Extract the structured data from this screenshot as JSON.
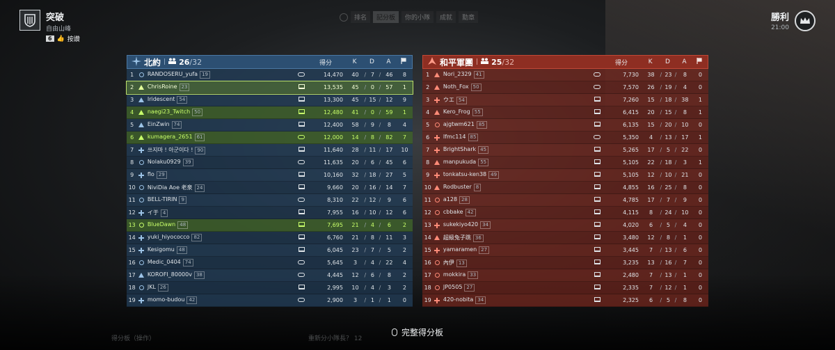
{
  "top_left": {
    "name": "突破",
    "subtitle": "自由山峰",
    "likes_count": "6",
    "likes_label": "按讚"
  },
  "top_tabs": [
    "排名",
    "記分板",
    "你的小隊",
    "成就",
    "勳章"
  ],
  "result": {
    "label": "勝利",
    "time": "21:00"
  },
  "columns": {
    "score": "得分",
    "k": "K",
    "d": "D",
    "a": "A"
  },
  "blue": {
    "name": "北約",
    "count": "26",
    "max": "/32",
    "players": [
      {
        "rank": "1",
        "icon": "ring",
        "name": "RANDOSERU_yufa",
        "lvl": "19",
        "plat": "ctrl",
        "score": "14,470",
        "k": "40",
        "d": "7",
        "a": "46",
        "f": "8",
        "state": ""
      },
      {
        "rank": "2",
        "icon": "tri",
        "name": "ChrisRoine",
        "lvl": "23",
        "plat": "pc",
        "score": "13,535",
        "k": "45",
        "d": "0",
        "a": "57",
        "f": "1",
        "state": "self"
      },
      {
        "rank": "3",
        "icon": "tri",
        "name": "Iridescent",
        "lvl": "54",
        "plat": "pc",
        "score": "13,300",
        "k": "45",
        "d": "15",
        "a": "12",
        "f": "9",
        "state": ""
      },
      {
        "rank": "4",
        "icon": "tri",
        "name": "naegi23_Twitch",
        "lvl": "50",
        "plat": "pc",
        "score": "12,480",
        "k": "41",
        "d": "0",
        "a": "59",
        "f": "1",
        "state": "squad"
      },
      {
        "rank": "5",
        "icon": "tri",
        "name": "EinZwin",
        "lvl": "74",
        "plat": "pc",
        "score": "12,400",
        "k": "58",
        "d": "9",
        "a": "8",
        "f": "4",
        "state": ""
      },
      {
        "rank": "6",
        "icon": "tri",
        "name": "kumagera_2651",
        "lvl": "61",
        "plat": "ctrl",
        "score": "12,000",
        "k": "14",
        "d": "8",
        "a": "82",
        "f": "7",
        "state": "squad"
      },
      {
        "rank": "7",
        "icon": "cross",
        "name": "쓰지마 ! 아군이다 !",
        "lvl": "90",
        "plat": "pc",
        "score": "11,640",
        "k": "28",
        "d": "11",
        "a": "17",
        "f": "10",
        "state": ""
      },
      {
        "rank": "8",
        "icon": "ring",
        "name": "Nolaku0929",
        "lvl": "39",
        "plat": "ctrl",
        "score": "11,635",
        "k": "20",
        "d": "6",
        "a": "45",
        "f": "6",
        "state": ""
      },
      {
        "rank": "9",
        "icon": "cross",
        "name": "flo",
        "lvl": "29",
        "plat": "pc",
        "score": "10,160",
        "k": "32",
        "d": "18",
        "a": "27",
        "f": "5",
        "state": ""
      },
      {
        "rank": "10",
        "icon": "ring",
        "name": "NiviDia Aoe 老泉",
        "lvl": "24",
        "plat": "pc",
        "score": "9,660",
        "k": "20",
        "d": "16",
        "a": "14",
        "f": "7",
        "state": ""
      },
      {
        "rank": "11",
        "icon": "ring",
        "name": "BELL-TIRIN",
        "lvl": "9",
        "plat": "ctrl",
        "score": "8,310",
        "k": "22",
        "d": "12",
        "a": "9",
        "f": "6",
        "state": ""
      },
      {
        "rank": "12",
        "icon": "cross",
        "name": "イ于",
        "lvl": "4",
        "plat": "pc",
        "score": "7,955",
        "k": "16",
        "d": "10",
        "a": "12",
        "f": "6",
        "state": ""
      },
      {
        "rank": "13",
        "icon": "ring",
        "name": "BlueDawn",
        "lvl": "48",
        "plat": "pc",
        "score": "7,695",
        "k": "21",
        "d": "4",
        "a": "6",
        "f": "2",
        "state": "squad"
      },
      {
        "rank": "14",
        "icon": "cross",
        "name": "yuki_hiyococco",
        "lvl": "82",
        "plat": "pc",
        "score": "6,760",
        "k": "21",
        "d": "8",
        "a": "11",
        "f": "3",
        "state": ""
      },
      {
        "rank": "15",
        "icon": "cross",
        "name": "Kesigomu",
        "lvl": "48",
        "plat": "pc",
        "score": "6,045",
        "k": "23",
        "d": "7",
        "a": "5",
        "f": "2",
        "state": ""
      },
      {
        "rank": "16",
        "icon": "ring",
        "name": "Medic_0404",
        "lvl": "74",
        "plat": "ctrl",
        "score": "5,645",
        "k": "3",
        "d": "4",
        "a": "22",
        "f": "4",
        "state": ""
      },
      {
        "rank": "17",
        "icon": "tri",
        "name": "KOROFI_80000v",
        "lvl": "38",
        "plat": "ctrl",
        "score": "4,445",
        "k": "12",
        "d": "6",
        "a": "8",
        "f": "2",
        "state": ""
      },
      {
        "rank": "18",
        "icon": "ring",
        "name": "JKL",
        "lvl": "26",
        "plat": "pc",
        "score": "2,995",
        "k": "10",
        "d": "4",
        "a": "3",
        "f": "2",
        "state": ""
      },
      {
        "rank": "19",
        "icon": "cross",
        "name": "momo-budou",
        "lvl": "42",
        "plat": "ctrl",
        "score": "2,900",
        "k": "3",
        "d": "1",
        "a": "1",
        "f": "0",
        "state": ""
      }
    ]
  },
  "red": {
    "name": "和平軍團",
    "count": "25",
    "max": "/32",
    "players": [
      {
        "rank": "1",
        "icon": "tri",
        "name": "Nori_2329",
        "lvl": "41",
        "plat": "ctrl",
        "score": "7,730",
        "k": "38",
        "d": "23",
        "a": "8",
        "f": "0"
      },
      {
        "rank": "2",
        "icon": "tri",
        "name": "Noth_Fox",
        "lvl": "50",
        "plat": "ctrl",
        "score": "7,570",
        "k": "26",
        "d": "19",
        "a": "4",
        "f": "0"
      },
      {
        "rank": "3",
        "icon": "cross",
        "name": "ウエ",
        "lvl": "54",
        "plat": "pc",
        "score": "7,260",
        "k": "15",
        "d": "18",
        "a": "38",
        "f": "1"
      },
      {
        "rank": "4",
        "icon": "tri",
        "name": "Kero_Frog",
        "lvl": "55",
        "plat": "pc",
        "score": "6,415",
        "k": "20",
        "d": "15",
        "a": "8",
        "f": "1"
      },
      {
        "rank": "5",
        "icon": "ring",
        "name": "ajgtwm621",
        "lvl": "85",
        "plat": "pc",
        "score": "6,135",
        "k": "15",
        "d": "20",
        "a": "10",
        "f": "0"
      },
      {
        "rank": "6",
        "icon": "cross",
        "name": "Ifmc114",
        "lvl": "85",
        "plat": "ctrl",
        "score": "5,350",
        "k": "4",
        "d": "13",
        "a": "17",
        "f": "1"
      },
      {
        "rank": "7",
        "icon": "cross",
        "name": "BrightShark",
        "lvl": "45",
        "plat": "pc",
        "score": "5,265",
        "k": "17",
        "d": "5",
        "a": "22",
        "f": "0"
      },
      {
        "rank": "8",
        "icon": "tri",
        "name": "manpukuda",
        "lvl": "55",
        "plat": "pc",
        "score": "5,105",
        "k": "22",
        "d": "18",
        "a": "3",
        "f": "1"
      },
      {
        "rank": "9",
        "icon": "cross",
        "name": "tonkatsu-ken38",
        "lvl": "49",
        "plat": "pc",
        "score": "5,105",
        "k": "12",
        "d": "10",
        "a": "21",
        "f": "0"
      },
      {
        "rank": "10",
        "icon": "tri",
        "name": "Rodbuster",
        "lvl": "8",
        "plat": "pc",
        "score": "4,855",
        "k": "16",
        "d": "25",
        "a": "8",
        "f": "0"
      },
      {
        "rank": "11",
        "icon": "ring",
        "name": "a128",
        "lvl": "28",
        "plat": "pc",
        "score": "4,785",
        "k": "17",
        "d": "7",
        "a": "9",
        "f": "0"
      },
      {
        "rank": "12",
        "icon": "ring",
        "name": "cbbake",
        "lvl": "42",
        "plat": "pc",
        "score": "4,115",
        "k": "8",
        "d": "24",
        "a": "10",
        "f": "0"
      },
      {
        "rank": "13",
        "icon": "cross",
        "name": "sukekiyo420",
        "lvl": "34",
        "plat": "pc",
        "score": "4,020",
        "k": "6",
        "d": "5",
        "a": "4",
        "f": "0"
      },
      {
        "rank": "14",
        "icon": "tri",
        "name": "超級兔子跳",
        "lvl": "36",
        "plat": "pc",
        "score": "3,480",
        "k": "12",
        "d": "8",
        "a": "1",
        "f": "0"
      },
      {
        "rank": "15",
        "icon": "cross",
        "name": "yamaramen",
        "lvl": "27",
        "plat": "pc",
        "score": "3,445",
        "k": "7",
        "d": "13",
        "a": "6",
        "f": "0"
      },
      {
        "rank": "16",
        "icon": "ring",
        "name": "內伊",
        "lvl": "13",
        "plat": "pc",
        "score": "3,235",
        "k": "13",
        "d": "16",
        "a": "7",
        "f": "0"
      },
      {
        "rank": "17",
        "icon": "ring",
        "name": "mokkira",
        "lvl": "33",
        "plat": "pc",
        "score": "2,480",
        "k": "7",
        "d": "13",
        "a": "1",
        "f": "0"
      },
      {
        "rank": "18",
        "icon": "ring",
        "name": "JP0505",
        "lvl": "27",
        "plat": "pc",
        "score": "2,335",
        "k": "7",
        "d": "12",
        "a": "1",
        "f": "0"
      },
      {
        "rank": "19",
        "icon": "cross",
        "name": "420-nobita",
        "lvl": "34",
        "plat": "pc",
        "score": "2,325",
        "k": "6",
        "d": "5",
        "a": "8",
        "f": "0"
      }
    ]
  },
  "footer": {
    "full_scoreboard": "完整得分板"
  },
  "bottom_faint": [
    "得分板（操作）",
    "重新分小隊長？ 12"
  ],
  "colors": {
    "blue_header": "#2c4f72",
    "red_header": "#8e2e22",
    "squad_green": "#c8ff6a"
  }
}
